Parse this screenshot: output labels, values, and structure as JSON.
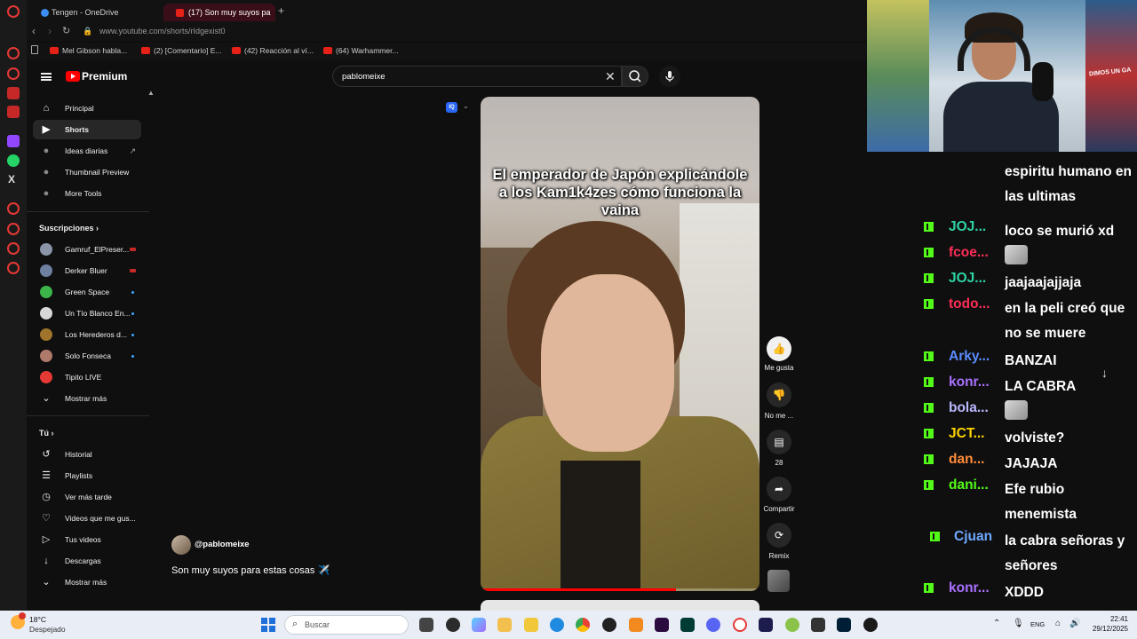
{
  "browser": {
    "tabs": [
      {
        "label": "Tengen - OneDrive",
        "active": false
      },
      {
        "label": "(17) Son muy suyos pa",
        "active": true
      }
    ],
    "new_tab_glyph": "+",
    "url": "www.youtube.com/shorts/rIdgexist0",
    "bookmarks": [
      "Mel Gibson habla...",
      "(2) [Comentario] E...",
      "(42) Reacción al ví...",
      "(64) Warhammer..."
    ]
  },
  "youtube": {
    "brand": "Premium",
    "search": {
      "value": "pablomeixe"
    },
    "sidebar": {
      "main": [
        {
          "label": "Principal",
          "icon": "home-icon"
        },
        {
          "label": "Shorts",
          "icon": "shorts-icon",
          "active": true
        },
        {
          "label": "Ideas diarias",
          "icon": "ideas-icon"
        },
        {
          "label": "Thumbnail Preview",
          "icon": "extension-icon"
        },
        {
          "label": "More Tools",
          "icon": "extension-icon"
        }
      ],
      "subscriptions_heading": "Suscripciones",
      "subscriptions": [
        {
          "label": "Gamruf_ElPreser...",
          "status": "live"
        },
        {
          "label": "Derker Bluer",
          "status": "live"
        },
        {
          "label": "Green Space",
          "status": "new"
        },
        {
          "label": "Un Tío Blanco En...",
          "status": "new"
        },
        {
          "label": "Los Herederos d...",
          "status": "new"
        },
        {
          "label": "Solo Fonseca",
          "status": "new"
        },
        {
          "label": "Tipito LIVE",
          "status": ""
        },
        {
          "label": "Mostrar más",
          "status": ""
        }
      ],
      "you_heading": "Tú",
      "you": [
        {
          "label": "Historial",
          "icon": "history-icon"
        },
        {
          "label": "Playlists",
          "icon": "playlist-icon"
        },
        {
          "label": "Ver más tarde",
          "icon": "clock-icon"
        },
        {
          "label": "Videos que me gus...",
          "icon": "like-icon"
        },
        {
          "label": "Tus videos",
          "icon": "video-icon"
        },
        {
          "label": "Descargas",
          "icon": "download-icon"
        },
        {
          "label": "Mostrar más",
          "icon": "chevron-down-icon"
        }
      ]
    },
    "short": {
      "caption": "El emperador de Japón explicándole a los Kam1k4zes cómo funciona la vaina",
      "progress": 0.7,
      "channel": "@pablomeixe",
      "title": "Son muy suyos para estas cosas ✈️",
      "actions": {
        "like": "Me gusta",
        "dislike": "No me ...",
        "comments": "28",
        "share": "Compartir",
        "remix": "Remix"
      }
    },
    "extension_badge": "IQ"
  },
  "webcam": {
    "sign_text": "DIMOS UN GA"
  },
  "chat": [
    {
      "user": "",
      "text": "espiritu humano en las ultimas",
      "user_color": "#ffffff"
    },
    {
      "user": "JOJ...",
      "text": "loco se murió xd",
      "user_color": "#2ed3a5"
    },
    {
      "user": "fcoe...",
      "text": "",
      "emote": true,
      "user_color": "#ff2d55"
    },
    {
      "user": "JOJ...",
      "text": "jaajaajajjaja",
      "user_color": "#2ed3a5"
    },
    {
      "user": "todo...",
      "text": "en la peli creó que no se muere",
      "user_color": "#ff2d55"
    },
    {
      "user": "Arky...",
      "text": "BANZAI",
      "user_color": "#5b8cff"
    },
    {
      "user": "konr...",
      "text": "LA CABRA",
      "user_color": "#a970ff"
    },
    {
      "user": "bola...",
      "text": "",
      "emote": true,
      "user_color": "#b9b9ff"
    },
    {
      "user": "JCT...",
      "text": "volviste?",
      "user_color": "#ffd400"
    },
    {
      "user": "dan...",
      "text": "JAJAJA",
      "user_color": "#ff8c3a"
    },
    {
      "user": "dani...",
      "text": "Efe rubio menemista",
      "user_color": "#53fc18"
    },
    {
      "user": "Cjuan",
      "text": "la cabra señoras y señores",
      "user_color": "#6fa8ff"
    },
    {
      "user": "konr...",
      "text": "XDDD",
      "user_color": "#a970ff"
    }
  ],
  "taskbar": {
    "weather_temp": "18°C",
    "weather_desc": "Despejado",
    "weather_badge": "1",
    "search_placeholder": "Buscar",
    "lang": "ENG",
    "time": "22:41",
    "date": "29/12/2025"
  },
  "colors": {
    "youtube_red": "#ff0000",
    "kick_green": "#53fc18",
    "taskbar_bg": "#e8edf6"
  }
}
